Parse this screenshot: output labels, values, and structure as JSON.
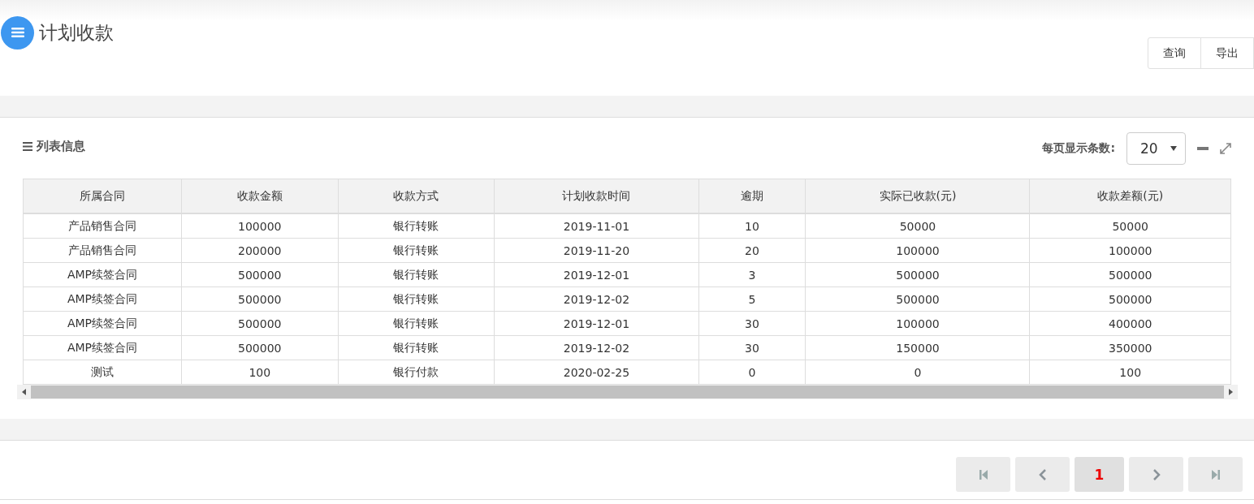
{
  "page": {
    "title": "计划收款"
  },
  "toolbar": {
    "buttons": [
      "查询",
      "导出"
    ]
  },
  "panel": {
    "title": "列表信息",
    "page_size_label": "每页显示条数:",
    "page_size": "20"
  },
  "table": {
    "columns": [
      "所属合同",
      "收款金额",
      "收款方式",
      "计划收款时间",
      "逾期",
      "实际已收款(元)",
      "收款差额(元)"
    ],
    "rows": [
      [
        "产品销售合同",
        "100000",
        "银行转账",
        "2019-11-01",
        "10",
        "50000",
        "50000"
      ],
      [
        "产品销售合同",
        "200000",
        "银行转账",
        "2019-11-20",
        "20",
        "100000",
        "100000"
      ],
      [
        "AMP续签合同",
        "500000",
        "银行转账",
        "2019-12-01",
        "3",
        "500000",
        "500000"
      ],
      [
        "AMP续签合同",
        "500000",
        "银行转账",
        "2019-12-02",
        "5",
        "500000",
        "500000"
      ],
      [
        "AMP续签合同",
        "500000",
        "银行转账",
        "2019-12-01",
        "30",
        "100000",
        "400000"
      ],
      [
        "AMP续签合同",
        "500000",
        "银行转账",
        "2019-12-02",
        "30",
        "150000",
        "350000"
      ],
      [
        "测试",
        "100",
        "银行付款",
        "2020-02-25",
        "0",
        "0",
        "100"
      ]
    ]
  },
  "pagination": {
    "pages": [
      {
        "label": "1",
        "selected": true
      }
    ]
  }
}
